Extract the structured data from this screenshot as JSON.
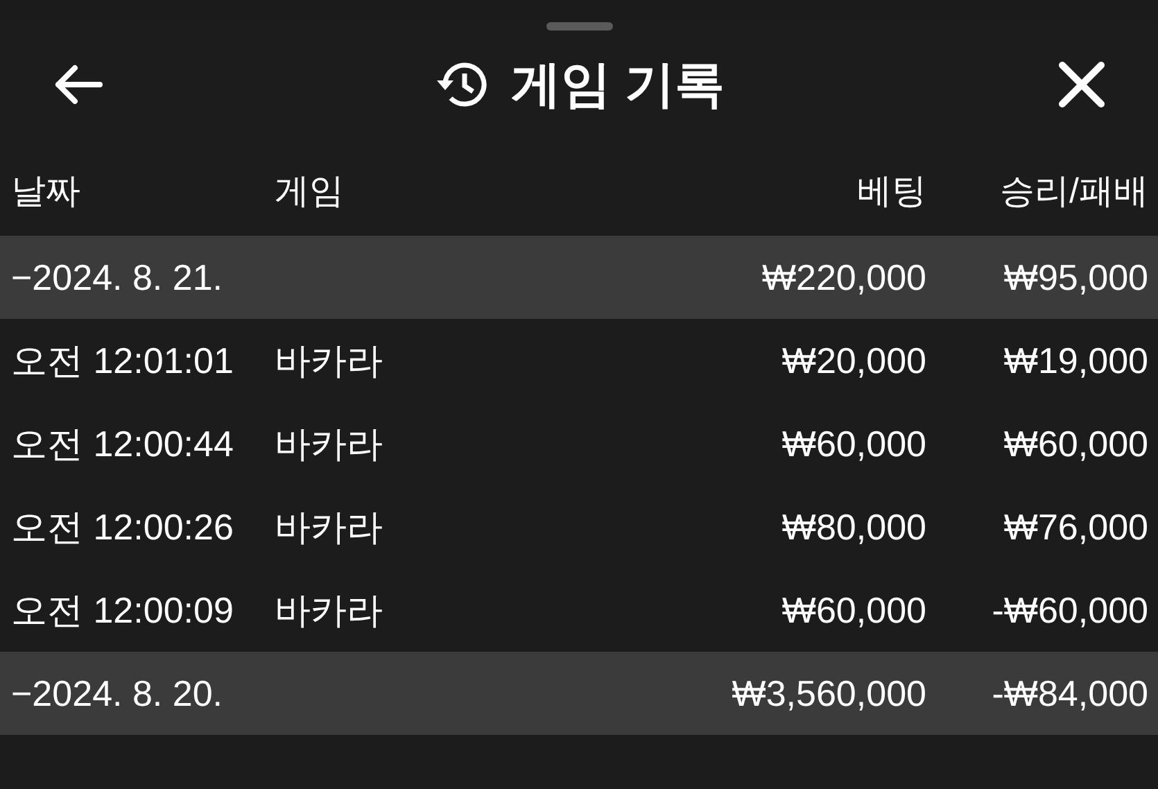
{
  "sheet": {
    "title": "게임 기록"
  },
  "columns": [
    "날짜",
    "게임",
    "베팅",
    "승리/패배"
  ],
  "groups": [
    {
      "date": "−2024. 8. 21.",
      "bet": "₩220,000",
      "result": "₩95,000",
      "rounds": [
        {
          "time": "오전 12:01:01",
          "game": "바카라",
          "bet": "₩20,000",
          "result": "₩19,000"
        },
        {
          "time": "오전 12:00:44",
          "game": "바카라",
          "bet": "₩60,000",
          "result": "₩60,000"
        },
        {
          "time": "오전 12:00:26",
          "game": "바카라",
          "bet": "₩80,000",
          "result": "₩76,000"
        },
        {
          "time": "오전 12:00:09",
          "game": "바카라",
          "bet": "₩60,000",
          "result": "-₩60,000"
        }
      ]
    },
    {
      "date": "−2024. 8. 20.",
      "bet": "₩3,560,000",
      "result": "-₩84,000"
    }
  ]
}
